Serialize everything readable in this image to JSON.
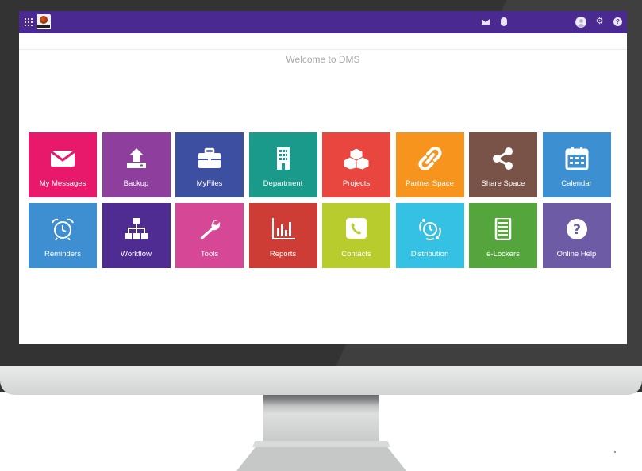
{
  "app": {
    "welcome_text": "Welcome to DMS"
  },
  "topbar": {
    "icons": [
      "apps-grid-icon",
      "app-logo",
      "mail-icon",
      "bell-icon",
      "user-avatar",
      "gear-icon",
      "help-icon"
    ],
    "color": "#4a2a90"
  },
  "tiles": [
    {
      "label": "My Messages",
      "icon": "envelope-icon",
      "color": "#e8196b"
    },
    {
      "label": "Backup",
      "icon": "upload-icon",
      "color": "#8e3f9d"
    },
    {
      "label": "MyFiles",
      "icon": "briefcase-icon",
      "color": "#3d4fa1"
    },
    {
      "label": "Department",
      "icon": "building-icon",
      "color": "#1a9a8a"
    },
    {
      "label": "Projects",
      "icon": "cubes-icon",
      "color": "#e8463f"
    },
    {
      "label": "Partner Space",
      "icon": "link-icon",
      "color": "#f7941d"
    },
    {
      "label": "Share Space",
      "icon": "share-icon",
      "color": "#7a5348"
    },
    {
      "label": "Calendar",
      "icon": "calendar-icon",
      "color": "#3c8fd0"
    },
    {
      "label": "Reminders",
      "icon": "alarm-clock-icon",
      "color": "#3e8fd2"
    },
    {
      "label": "Workflow",
      "icon": "sitemap-icon",
      "color": "#4e2c91"
    },
    {
      "label": "Tools",
      "icon": "wrench-icon",
      "color": "#d64795"
    },
    {
      "label": "Reports",
      "icon": "bar-chart-icon",
      "color": "#ce3d35"
    },
    {
      "label": "Contacts",
      "icon": "phone-icon",
      "color": "#b8cc2e"
    },
    {
      "label": "Distribution",
      "icon": "clock-arrows-icon",
      "color": "#34c1e3"
    },
    {
      "label": "e-Lockers",
      "icon": "locker-icon",
      "color": "#55a53d"
    },
    {
      "label": "Online Help",
      "icon": "question-icon",
      "color": "#6d5ba6"
    }
  ]
}
